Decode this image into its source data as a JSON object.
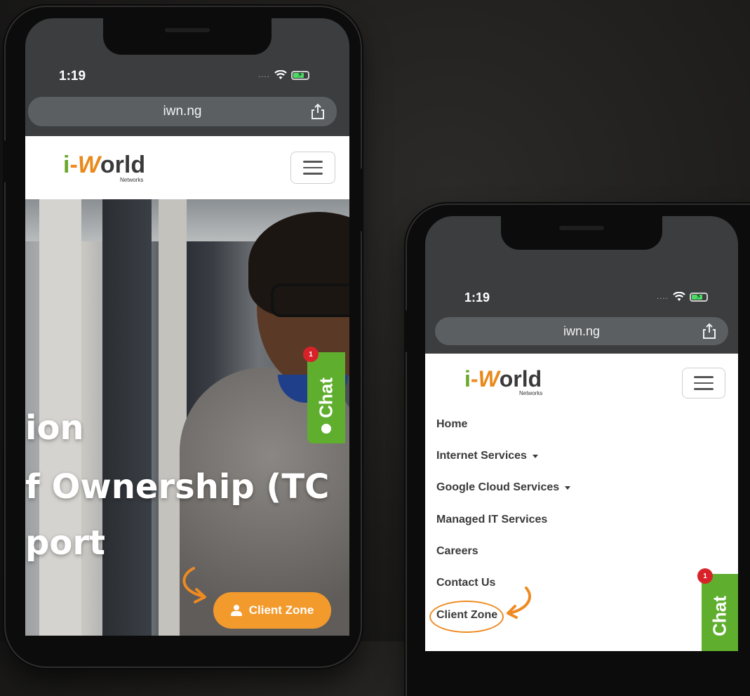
{
  "left_phone": {
    "status": {
      "time": "1:19"
    },
    "browser": {
      "url": "iwn.ng"
    },
    "logo": {
      "i": "i",
      "dash": "-",
      "w": "W",
      "rest": "orld",
      "sub": "Networks"
    },
    "hero_lines": [
      "ion",
      "f Ownership (TC",
      "port"
    ],
    "client_zone_button": "Client Zone",
    "chat": {
      "label": "Chat",
      "badge": "1"
    }
  },
  "right_phone": {
    "status": {
      "time": "1:19"
    },
    "browser": {
      "url": "iwn.ng"
    },
    "logo": {
      "i": "i",
      "dash": "-",
      "w": "W",
      "rest": "orld",
      "sub": "Networks"
    },
    "nav_items": [
      {
        "label": "Home",
        "has_dropdown": false
      },
      {
        "label": "Internet Services",
        "has_dropdown": true
      },
      {
        "label": "Google Cloud Services",
        "has_dropdown": true
      },
      {
        "label": "Managed IT Services",
        "has_dropdown": false
      },
      {
        "label": "Careers",
        "has_dropdown": false
      },
      {
        "label": "Contact Us",
        "has_dropdown": false
      },
      {
        "label": "Client Zone",
        "has_dropdown": false
      }
    ],
    "chat": {
      "label": "Chat",
      "badge": "1"
    }
  },
  "colors": {
    "accent_orange": "#f39a2c",
    "chat_green": "#5fae2e",
    "badge_red": "#d8222a"
  }
}
